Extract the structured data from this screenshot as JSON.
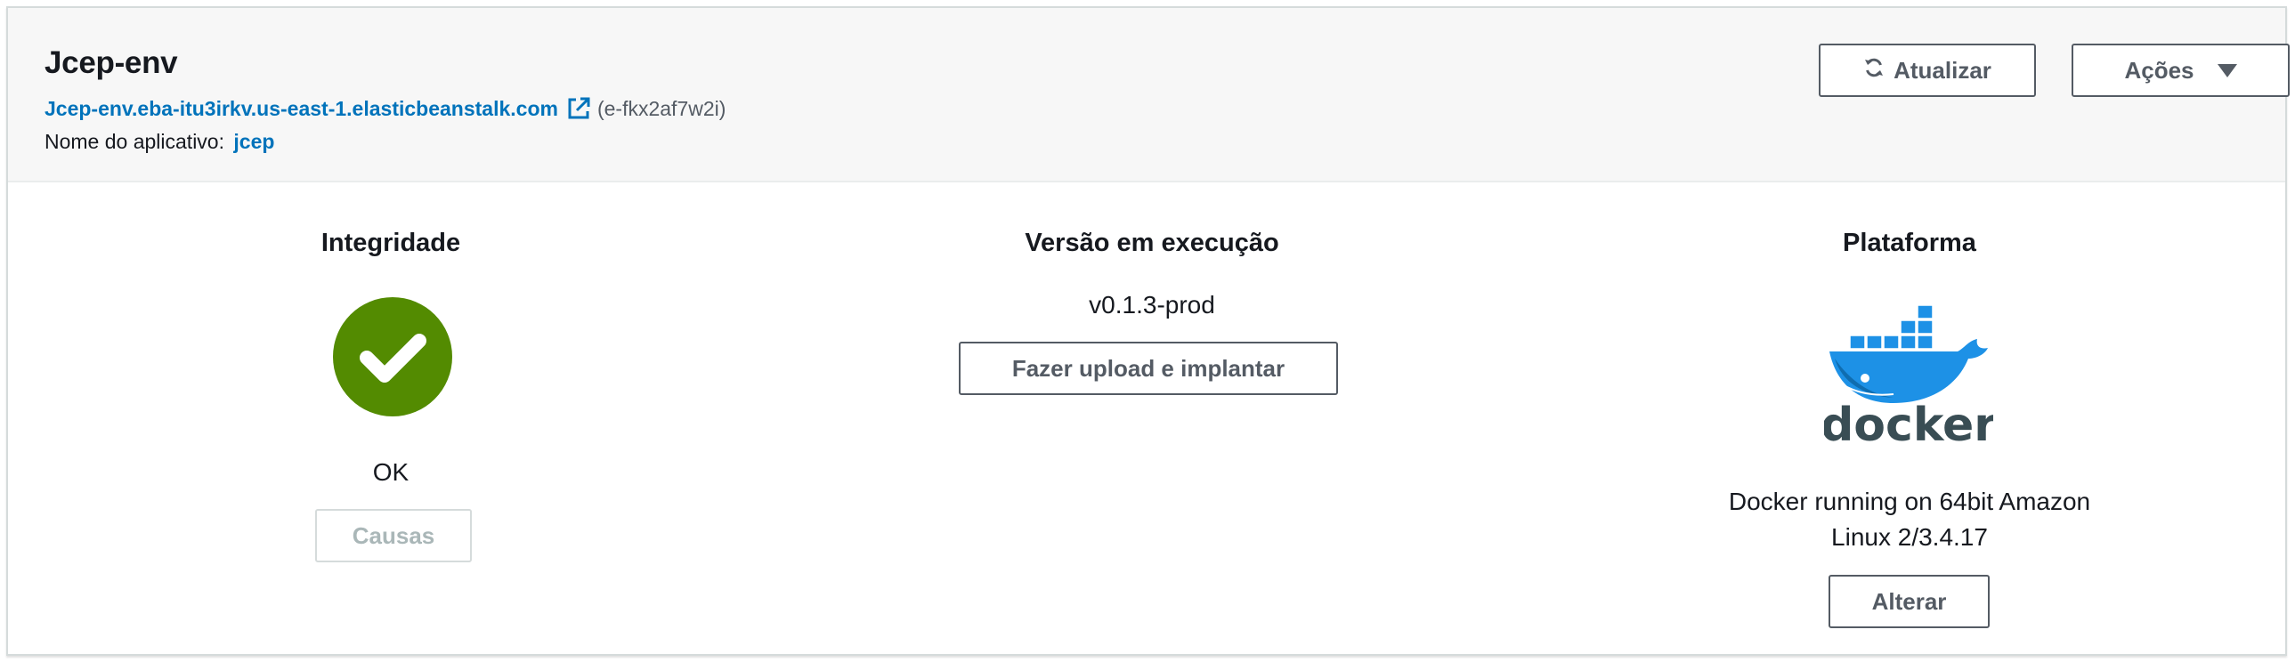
{
  "environment": {
    "name": "Jcep-env",
    "url": "Jcep-env.eba-itu3irkv.us-east-1.elasticbeanstalk.com",
    "id": "(e-fkx2af7w2i)",
    "app_label": "Nome do aplicativo:",
    "app_name": "jcep"
  },
  "toolbar": {
    "refresh_label": "Atualizar",
    "actions_label": "Ações"
  },
  "health": {
    "title": "Integridade",
    "status": "OK",
    "causes_label": "Causas",
    "color": "#538b01"
  },
  "version": {
    "title": "Versão em execução",
    "value": "v0.1.3-prod",
    "deploy_label": "Fazer upload e implantar"
  },
  "platform": {
    "title": "Plataforma",
    "logo_text": "docker",
    "description": "Docker running on 64bit Amazon Linux 2/3.4.17",
    "change_label": "Alterar",
    "logo_color": "#1d91e6"
  },
  "colors": {
    "link": "#0073bb",
    "header_bg": "#f7f7f7",
    "button_border": "#545b64"
  }
}
